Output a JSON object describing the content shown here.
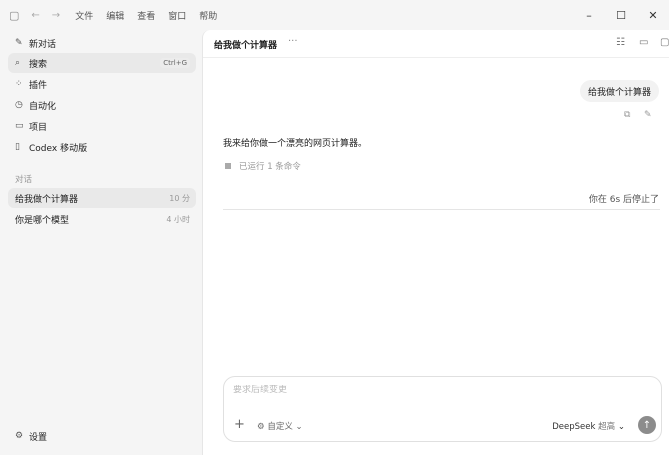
{
  "titlebar": {
    "menus": [
      "文件",
      "编辑",
      "查看",
      "窗口",
      "帮助"
    ],
    "icons": {
      "sidebar_toggle": "▢",
      "back": "←",
      "forward": "→",
      "minimize": "–",
      "maximize": "☐",
      "close": "✕"
    }
  },
  "sidebar": {
    "items": [
      {
        "icon": "✎",
        "label": "新对话"
      },
      {
        "icon": "⌕",
        "label": "搜索",
        "shortcut": "Ctrl+G"
      },
      {
        "icon": "⁘",
        "label": "插件"
      },
      {
        "icon": "◷",
        "label": "自动化"
      },
      {
        "icon": "▭",
        "label": "项目"
      },
      {
        "icon": "▯",
        "label": "Codex 移动版"
      }
    ],
    "section_label": "对话",
    "conversations": [
      {
        "title": "给我做个计算器",
        "time": "10 分"
      },
      {
        "title": "你是哪个模型",
        "time": "4 小时"
      }
    ],
    "settings": {
      "icon": "⚙",
      "label": "设置"
    }
  },
  "main": {
    "title": "给我做个计算器",
    "more": "···",
    "header_icons": {
      "tasks": "☷",
      "terminal": "▭",
      "panel": "▢"
    },
    "user_message": "给我做个计算器",
    "message_actions": {
      "copy": "⧉",
      "edit": "✎"
    },
    "assistant_message": "我来给你做一个漂亮的网页计算器。",
    "ran_commands": "已运行 1 条命令",
    "stopped_status": "你在 6s 后停止了"
  },
  "composer": {
    "placeholder": "要求后续变更",
    "plus": "+",
    "custom_label": "自定义",
    "model": "DeepSeek",
    "effort": "超高",
    "send": "↑"
  },
  "colors": {
    "sidebar_bg": "#f5f5f5",
    "main_bg": "#ffffff",
    "send_bg": "#8c8c8c"
  }
}
